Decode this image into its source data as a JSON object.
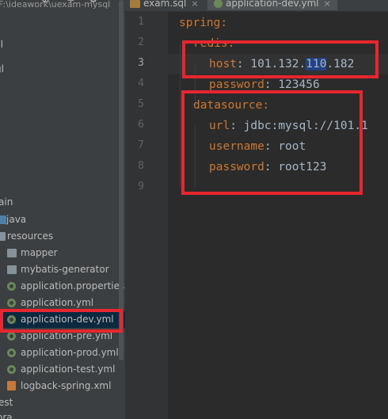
{
  "project": {
    "path_prefix": "F:\\ideawork\\uexam-mysql",
    "partial_rows": [
      "gl",
      "ain",
      "est",
      "ora"
    ],
    "tree": [
      {
        "label": "java",
        "type": "folder-blue"
      },
      {
        "label": "resources",
        "type": "folder-res"
      },
      {
        "label": "mapper",
        "type": "folder"
      },
      {
        "label": "mybatis-generator",
        "type": "folder"
      },
      {
        "label": "application.properties",
        "type": "spring"
      },
      {
        "label": "application.yml",
        "type": "spring"
      },
      {
        "label": "application-dev.yml",
        "type": "spring",
        "selected": true
      },
      {
        "label": "application-pre.yml",
        "type": "spring"
      },
      {
        "label": "application-prod.yml",
        "type": "spring"
      },
      {
        "label": "application-test.yml",
        "type": "spring"
      },
      {
        "label": "logback-spring.xml",
        "type": "xml"
      }
    ]
  },
  "tabs": [
    {
      "label": "exam.sql",
      "icon": "sql-file-icon",
      "active": false
    },
    {
      "label": "application-dev.yml",
      "icon": "yaml-file-icon",
      "active": true
    }
  ],
  "editor": {
    "line_numbers": [
      "1",
      "2",
      "3",
      "4",
      "5",
      "6",
      "7",
      "8",
      "9"
    ],
    "current_line": "3",
    "lines": [
      {
        "key": "spring",
        "sep": ":",
        "value": ""
      },
      {
        "key": "redis",
        "sep": ":",
        "value": ""
      },
      {
        "key": "host",
        "sep": ": ",
        "value_pre": "101.132.",
        "value_sel": "110",
        "value_post": ".182"
      },
      {
        "key": "password",
        "sep": ": ",
        "value": "123456"
      },
      {
        "key": "datasource",
        "sep": ":",
        "value": ""
      },
      {
        "key": "url",
        "sep": ": ",
        "value": "jdbc:mysql://101.1"
      },
      {
        "key": "username",
        "sep": ": ",
        "value": "root"
      },
      {
        "key": "password",
        "sep": ": ",
        "value": "root123"
      },
      {
        "key": "",
        "sep": "",
        "value": ""
      }
    ]
  },
  "colors": {
    "annotation": "#e8262f",
    "key": "#cc7832",
    "value": "#a9b7c6",
    "selection": "#214283"
  }
}
